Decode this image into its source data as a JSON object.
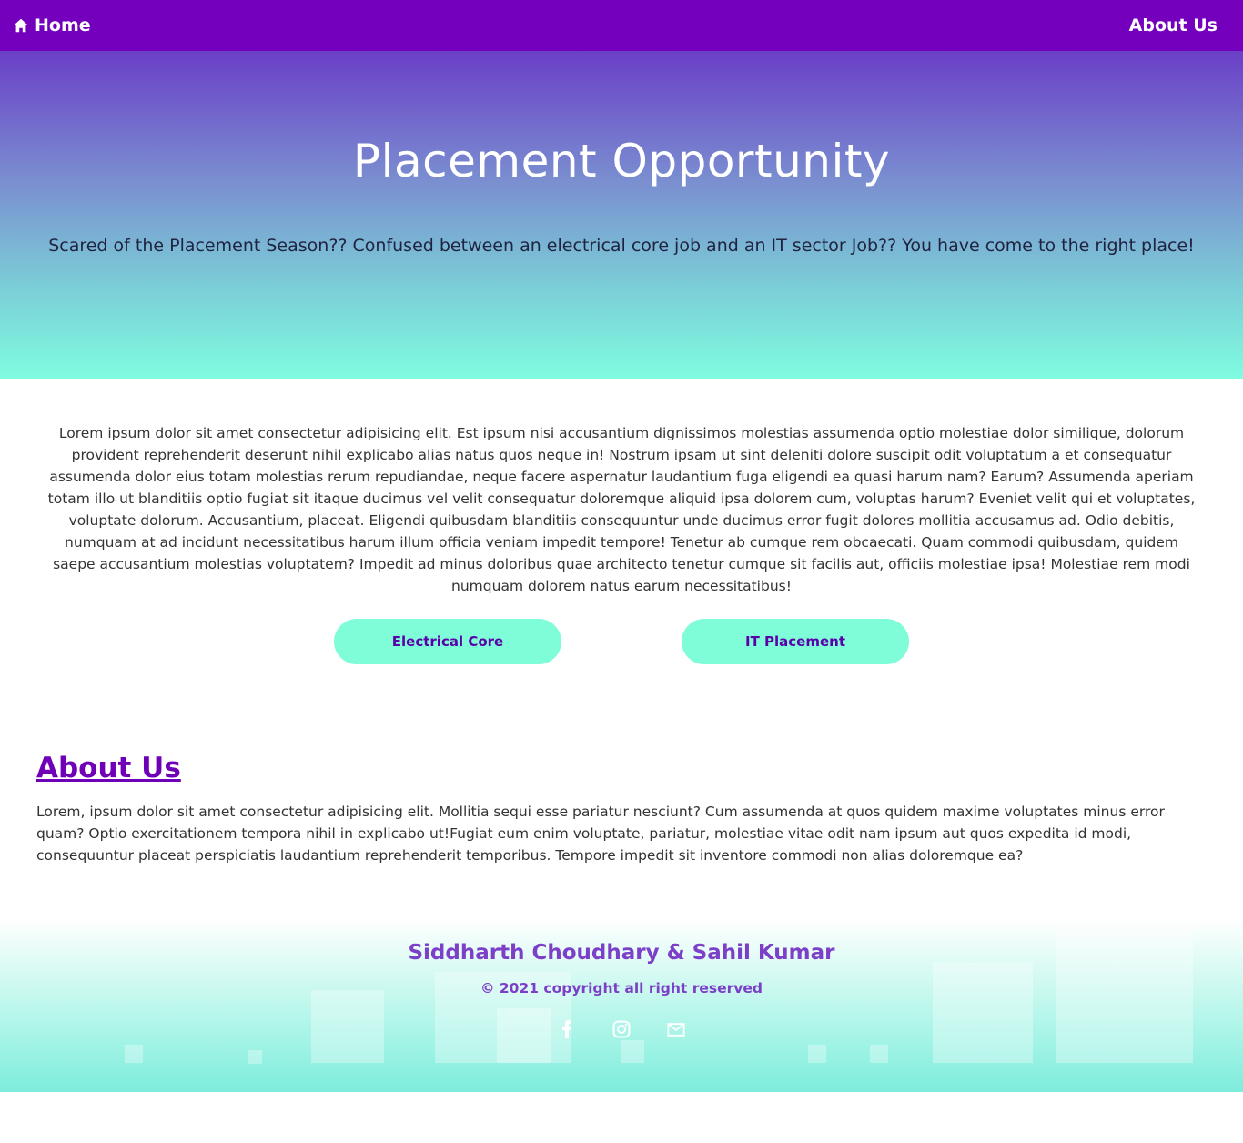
{
  "nav": {
    "home_label": "Home",
    "about_label": "About Us",
    "background": "#7400be"
  },
  "hero": {
    "title": "Placement Opportunity",
    "subtitle": "Scared of the Placement Season?? Confused between an electrical core job and an IT sector Job?? You have come to the right place!"
  },
  "intro": {
    "text": "Lorem ipsum dolor sit amet consectetur adipisicing elit. Est ipsum nisi accusantium dignissimos molestias assumenda optio molestiae dolor similique, dolorum provident reprehenderit deserunt nihil explicabo alias natus quos neque in! Nostrum ipsam ut sint deleniti dolore suscipit odit voluptatum a et consequatur assumenda dolor eius totam molestias rerum repudiandae, neque facere aspernatur laudantium fuga eligendi ea quasi harum nam? Earum? Assumenda aperiam totam illo ut blanditiis optio fugiat sit itaque ducimus vel velit consequatur doloremque aliquid ipsa dolorem cum, voluptas harum? Eveniet velit qui et voluptates, voluptate dolorum. Accusantium, placeat. Eligendi quibusdam blanditiis consequuntur unde ducimus error fugit dolores mollitia accusamus ad. Odio debitis, numquam at ad incidunt necessitatibus harum illum officia veniam impedit tempore! Tenetur ab cumque rem obcaecati. Quam commodi quibusdam, quidem saepe accusantium molestias voluptatem? Impedit ad minus doloribus quae architecto tenetur cumque sit facilis aut, officiis molestiae ipsa! Molestiae rem modi numquam dolorem natus earum necessitatibus!"
  },
  "buttons": {
    "electrical": "Electrical Core",
    "it": "IT Placement"
  },
  "about": {
    "title": "About Us",
    "text": "Lorem, ipsum dolor sit amet consectetur adipisicing elit. Mollitia sequi esse pariatur nesciunt? Cum assumenda at quos quidem maxime voluptates minus error quam? Optio exercitationem tempora nihil in explicabo ut!Fugiat eum enim voluptate, pariatur, molestiae vitae odit nam ipsum aut quos expedita id modi, consequuntur placeat perspiciatis laudantium reprehenderit temporibus. Tempore impedit sit inventore commodi non alias doloremque ea?"
  },
  "footer": {
    "names": "Siddharth Choudhary & Sahil Kumar",
    "copyright": "© 2021 copyright all right reserved",
    "socials": [
      "facebook-icon",
      "instagram-icon",
      "mail-icon"
    ]
  },
  "colors": {
    "accent": "#7400be",
    "button_bg": "#7ffcd8",
    "footer_text": "#7b3fc8"
  }
}
